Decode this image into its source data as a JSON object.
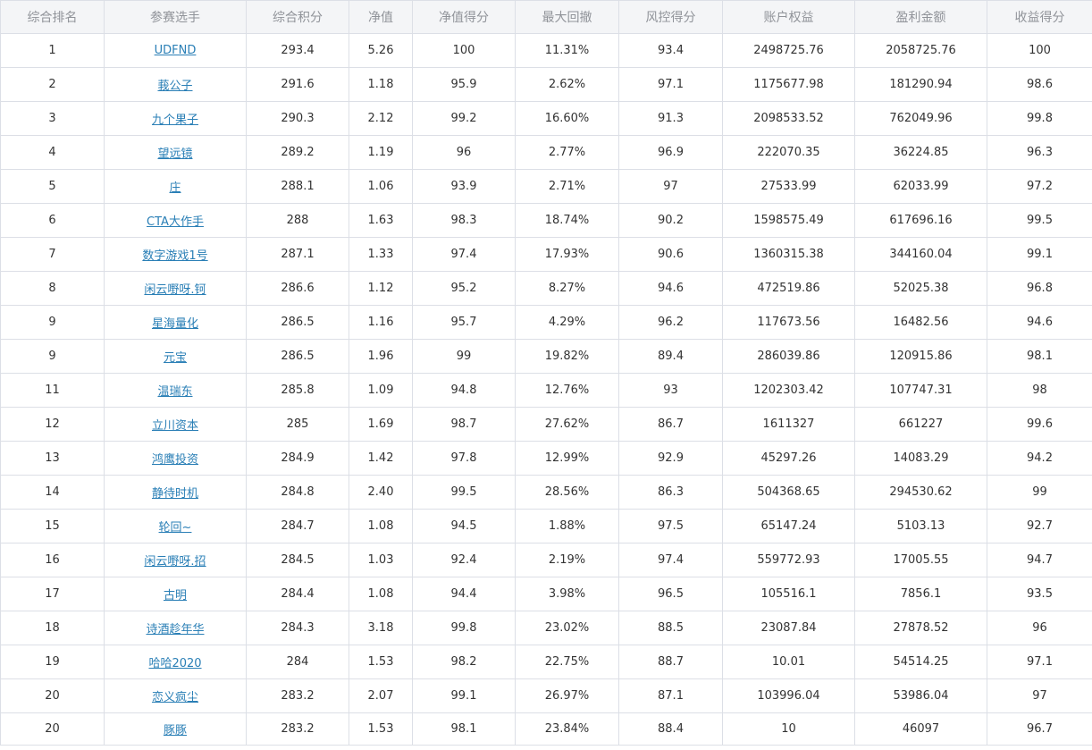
{
  "table": {
    "headers": [
      "综合排名",
      "参赛选手",
      "综合积分",
      "净值",
      "净值得分",
      "最大回撤",
      "风控得分",
      "账户权益",
      "盈利金额",
      "收益得分"
    ],
    "rows": [
      {
        "rank": "1",
        "player": "UDFND",
        "total_score": "293.4",
        "nav": "5.26",
        "nav_score": "100",
        "max_drawdown": "11.31%",
        "risk_score": "93.4",
        "equity": "2498725.76",
        "profit": "2058725.76",
        "return_score": "100"
      },
      {
        "rank": "2",
        "player": "莪公子",
        "total_score": "291.6",
        "nav": "1.18",
        "nav_score": "95.9",
        "max_drawdown": "2.62%",
        "risk_score": "97.1",
        "equity": "1175677.98",
        "profit": "181290.94",
        "return_score": "98.6"
      },
      {
        "rank": "3",
        "player": "九个果子",
        "total_score": "290.3",
        "nav": "2.12",
        "nav_score": "99.2",
        "max_drawdown": "16.60%",
        "risk_score": "91.3",
        "equity": "2098533.52",
        "profit": "762049.96",
        "return_score": "99.8"
      },
      {
        "rank": "4",
        "player": "望远镜",
        "total_score": "289.2",
        "nav": "1.19",
        "nav_score": "96",
        "max_drawdown": "2.77%",
        "risk_score": "96.9",
        "equity": "222070.35",
        "profit": "36224.85",
        "return_score": "96.3"
      },
      {
        "rank": "5",
        "player": "庄",
        "total_score": "288.1",
        "nav": "1.06",
        "nav_score": "93.9",
        "max_drawdown": "2.71%",
        "risk_score": "97",
        "equity": "27533.99",
        "profit": "62033.99",
        "return_score": "97.2"
      },
      {
        "rank": "6",
        "player": "CTA大作手",
        "total_score": "288",
        "nav": "1.63",
        "nav_score": "98.3",
        "max_drawdown": "18.74%",
        "risk_score": "90.2",
        "equity": "1598575.49",
        "profit": "617696.16",
        "return_score": "99.5"
      },
      {
        "rank": "7",
        "player": "数字游戏1号",
        "total_score": "287.1",
        "nav": "1.33",
        "nav_score": "97.4",
        "max_drawdown": "17.93%",
        "risk_score": "90.6",
        "equity": "1360315.38",
        "profit": "344160.04",
        "return_score": "99.1"
      },
      {
        "rank": "8",
        "player": "闲云嘢呀.钶",
        "total_score": "286.6",
        "nav": "1.12",
        "nav_score": "95.2",
        "max_drawdown": "8.27%",
        "risk_score": "94.6",
        "equity": "472519.86",
        "profit": "52025.38",
        "return_score": "96.8"
      },
      {
        "rank": "9",
        "player": "星海量化",
        "total_score": "286.5",
        "nav": "1.16",
        "nav_score": "95.7",
        "max_drawdown": "4.29%",
        "risk_score": "96.2",
        "equity": "117673.56",
        "profit": "16482.56",
        "return_score": "94.6"
      },
      {
        "rank": "9",
        "player": "元宝",
        "total_score": "286.5",
        "nav": "1.96",
        "nav_score": "99",
        "max_drawdown": "19.82%",
        "risk_score": "89.4",
        "equity": "286039.86",
        "profit": "120915.86",
        "return_score": "98.1"
      },
      {
        "rank": "11",
        "player": "温瑞东",
        "total_score": "285.8",
        "nav": "1.09",
        "nav_score": "94.8",
        "max_drawdown": "12.76%",
        "risk_score": "93",
        "equity": "1202303.42",
        "profit": "107747.31",
        "return_score": "98"
      },
      {
        "rank": "12",
        "player": "立川资本",
        "total_score": "285",
        "nav": "1.69",
        "nav_score": "98.7",
        "max_drawdown": "27.62%",
        "risk_score": "86.7",
        "equity": "1611327",
        "profit": "661227",
        "return_score": "99.6"
      },
      {
        "rank": "13",
        "player": "鸿鹰投资",
        "total_score": "284.9",
        "nav": "1.42",
        "nav_score": "97.8",
        "max_drawdown": "12.99%",
        "risk_score": "92.9",
        "equity": "45297.26",
        "profit": "14083.29",
        "return_score": "94.2"
      },
      {
        "rank": "14",
        "player": "静待时机",
        "total_score": "284.8",
        "nav": "2.40",
        "nav_score": "99.5",
        "max_drawdown": "28.56%",
        "risk_score": "86.3",
        "equity": "504368.65",
        "profit": "294530.62",
        "return_score": "99"
      },
      {
        "rank": "15",
        "player": "轮回~",
        "total_score": "284.7",
        "nav": "1.08",
        "nav_score": "94.5",
        "max_drawdown": "1.88%",
        "risk_score": "97.5",
        "equity": "65147.24",
        "profit": "5103.13",
        "return_score": "92.7"
      },
      {
        "rank": "16",
        "player": "闲云嘢呀.招",
        "total_score": "284.5",
        "nav": "1.03",
        "nav_score": "92.4",
        "max_drawdown": "2.19%",
        "risk_score": "97.4",
        "equity": "559772.93",
        "profit": "17005.55",
        "return_score": "94.7"
      },
      {
        "rank": "17",
        "player": "古明",
        "total_score": "284.4",
        "nav": "1.08",
        "nav_score": "94.4",
        "max_drawdown": "3.98%",
        "risk_score": "96.5",
        "equity": "105516.1",
        "profit": "7856.1",
        "return_score": "93.5"
      },
      {
        "rank": "18",
        "player": "诗酒趁年华",
        "total_score": "284.3",
        "nav": "3.18",
        "nav_score": "99.8",
        "max_drawdown": "23.02%",
        "risk_score": "88.5",
        "equity": "23087.84",
        "profit": "27878.52",
        "return_score": "96"
      },
      {
        "rank": "19",
        "player": "哈哈2020",
        "total_score": "284",
        "nav": "1.53",
        "nav_score": "98.2",
        "max_drawdown": "22.75%",
        "risk_score": "88.7",
        "equity": "10.01",
        "profit": "54514.25",
        "return_score": "97.1"
      },
      {
        "rank": "20",
        "player": "恋义疯尘",
        "total_score": "283.2",
        "nav": "2.07",
        "nav_score": "99.1",
        "max_drawdown": "26.97%",
        "risk_score": "87.1",
        "equity": "103996.04",
        "profit": "53986.04",
        "return_score": "97"
      },
      {
        "rank": "20",
        "player": "豚豚",
        "total_score": "283.2",
        "nav": "1.53",
        "nav_score": "98.1",
        "max_drawdown": "23.84%",
        "risk_score": "88.4",
        "equity": "10",
        "profit": "46097",
        "return_score": "96.7"
      }
    ]
  }
}
